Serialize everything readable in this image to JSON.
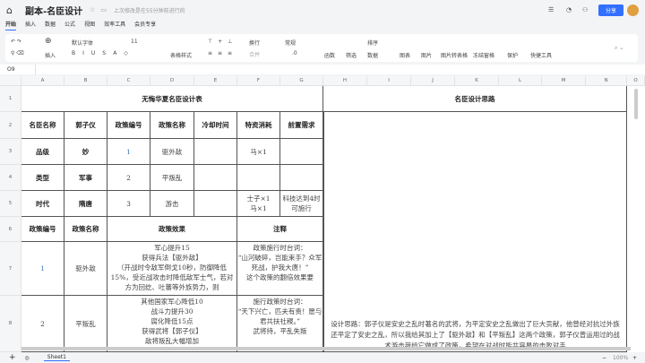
{
  "title": {
    "doc_name": "副本-名臣设计",
    "save_status": "上次修改是在55分钟前进行的",
    "share": "分享"
  },
  "menu": [
    "开始",
    "插入",
    "数据",
    "公式",
    "视图",
    "效率工具",
    "会员专享"
  ],
  "toolbar": {
    "insert": "插入",
    "font": "默认字体",
    "size": "11",
    "table_style": "表格样式",
    "wrap": "换行",
    "merge": "合并",
    "format": "常规",
    "decimal": ".0",
    "func": "函数",
    "filter": "筛选",
    "sort": "排序",
    "data": "数据",
    "chart": "图表",
    "image": "图片",
    "img2table": "图片转表格",
    "freeze": "冻结窗格",
    "protect": "保护",
    "quick": "快捷工具"
  },
  "cell_ref": "O9",
  "columns": [
    "A",
    "B",
    "C",
    "D",
    "E",
    "F",
    "G",
    "H",
    "I",
    "J",
    "K",
    "L",
    "M",
    "N",
    "O"
  ],
  "rows": [
    "1",
    "2",
    "3",
    "4",
    "5",
    "6",
    "7",
    "8"
  ],
  "sheet": {
    "title": "无悔华夏名臣设计表",
    "headers": [
      "名臣名称",
      "郭子仪",
      "政策编号",
      "政策名称",
      "冷却时间",
      "特资消耗",
      "前置需求"
    ],
    "r3": [
      "品级",
      "妙",
      "1",
      "驱外敌",
      "",
      "马×1",
      ""
    ],
    "r4": [
      "类型",
      "军事",
      "2",
      "平叛乱",
      "",
      "",
      ""
    ],
    "r5": [
      "时代",
      "隋唐",
      "3",
      "游击",
      "",
      "士子×1\n马×1",
      "科技达到4时可施行"
    ],
    "r6": [
      "政策编号",
      "政策名称",
      "政策效果",
      "注释"
    ],
    "r7": [
      "1",
      "驱外敌",
      "军心提升15\n获得兵法【驱外敌】\n（开战时令敌军倒戈10秒，防御降低15%，受近战攻击时降低敌军士气，若对方为回纥、吐蕃等外族势力，则",
      "政策施行时台词：\n“山河破碎，岂能束手？众军死战，护我大唐！”\n这个政策的翻倍效果要"
    ],
    "r8": [
      "2",
      "平叛乱",
      "其他国家军心降低10\n战斗力提升30\n腐化降低15点\n获得武将【郭子仪】\n敌将叛乱大幅增加",
      "施行政策时台词：\n“天下兴亡，匹夫有责！愿与君共扶社稷。”\n武将持，平乱失叛"
    ],
    "design_title": "名臣设计思路",
    "design_text": "设计思路：郭子仪是安史之乱时著名的武将，为平定安史之乱做出了巨大贡献，他曾经对抗过外族还平定了安史之乱，所以我给其加上了【驱外敌】和【平叛乱】这两个政策，郭子仪曾运用过的战术游击我给它做成了政策，希望在对战时能共容易的击败对手"
  },
  "tabs": {
    "sheet1": "Sheet1",
    "zoom": "100%"
  }
}
